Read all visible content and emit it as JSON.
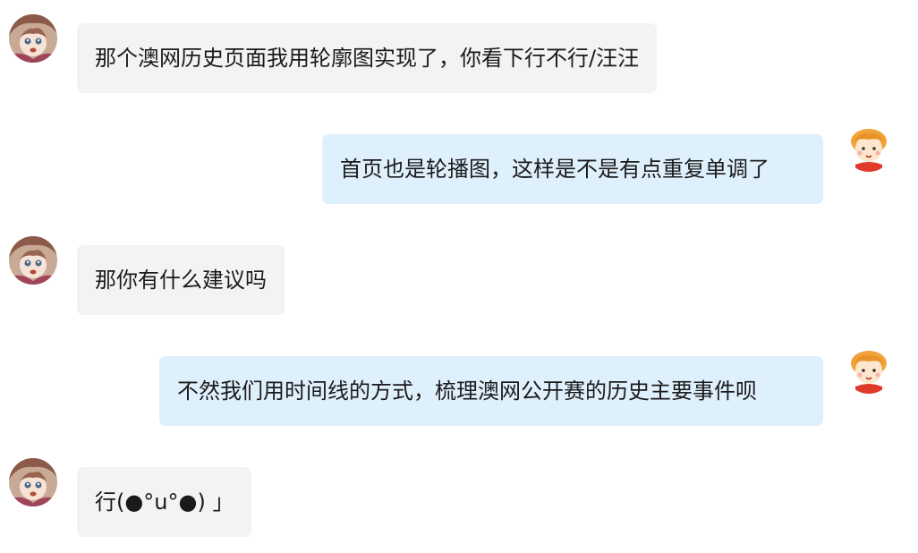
{
  "conversation": {
    "messages": [
      {
        "sender": "other",
        "text": "那个澳网历史页面我用轮廓图实现了，你看下行不行/汪汪"
      },
      {
        "sender": "self",
        "text": "首页也是轮播图，这样是不是有点重复单调了"
      },
      {
        "sender": "other",
        "text": "那你有什么建议吗"
      },
      {
        "sender": "self",
        "text": "不然我们用时间线的方式，梳理澳网公开赛的历史主要事件呗"
      },
      {
        "sender": "other",
        "text": "行(●°u°●) 」"
      }
    ]
  },
  "colors": {
    "incoming_bubble": "#f3f3f3",
    "outgoing_bubble": "#dff0fd",
    "text": "#1a1a1a"
  },
  "icons": {
    "other_avatar": "anime-girl-avatar",
    "self_avatar": "cartoon-child-avatar"
  }
}
